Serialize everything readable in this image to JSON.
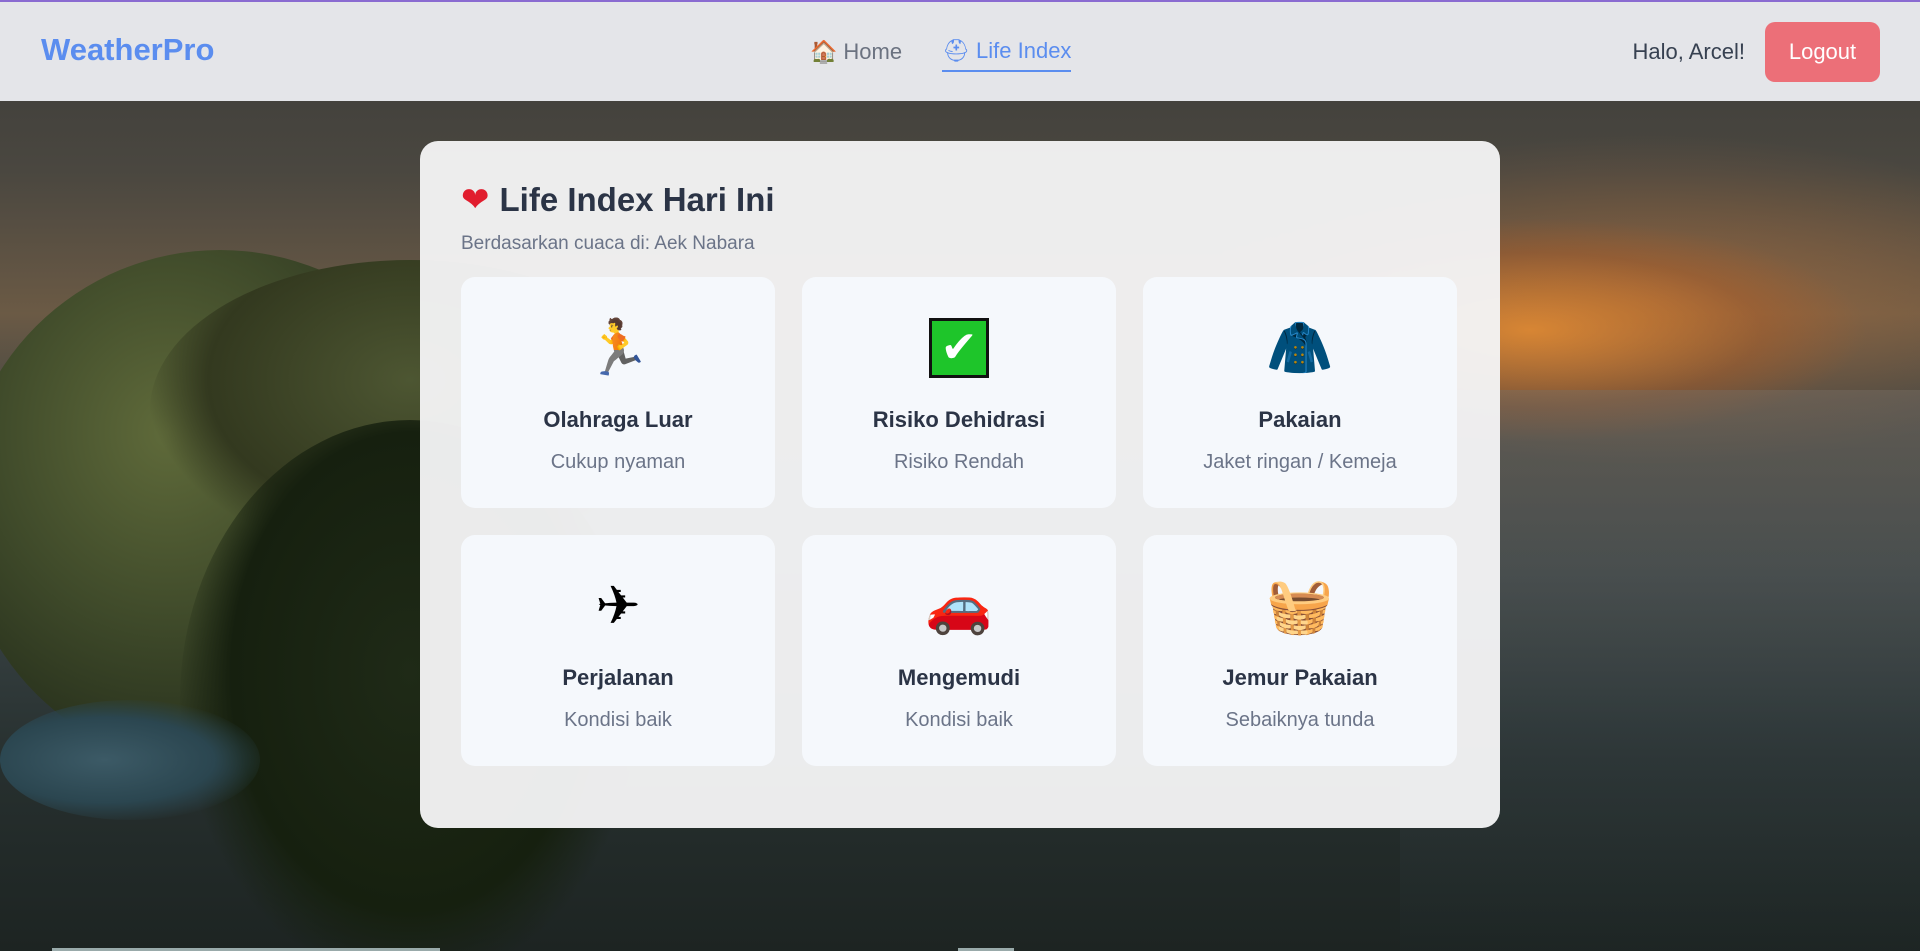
{
  "brand": {
    "name": "WeatherPro",
    "color": "#5b8def"
  },
  "nav": {
    "links": [
      {
        "label": "Home",
        "icon": "house-icon",
        "glyph": "🏠",
        "active": false
      },
      {
        "label": "Life Index",
        "icon": "life-index-icon",
        "glyph": "⛑",
        "active": true
      }
    ]
  },
  "user": {
    "greeting": "Halo, Arcel!",
    "logout_label": "Logout",
    "logout_color": "#ec6f78"
  },
  "life_index": {
    "title_icon": "heart-icon",
    "title_glyph": "❤",
    "title": "Life Index Hari Ini",
    "subtitle": "Berdasarkan cuaca di: Aek Nabara",
    "items": [
      {
        "icon": "runner-icon",
        "glyph": "🏃",
        "title": "Olahraga Luar",
        "value": "Cukup nyaman"
      },
      {
        "icon": "checkmark-icon",
        "glyph": "✔",
        "title": "Risiko Dehidrasi",
        "value": "Risiko Rendah"
      },
      {
        "icon": "jacket-icon",
        "glyph": "🧥",
        "title": "Pakaian",
        "value": "Jaket ringan / Kemeja"
      },
      {
        "icon": "airplane-icon",
        "glyph": "✈",
        "title": "Perjalanan",
        "value": "Kondisi baik"
      },
      {
        "icon": "car-icon",
        "glyph": "🚗",
        "title": "Mengemudi",
        "value": "Kondisi baik"
      },
      {
        "icon": "laundry-basket-icon",
        "glyph": "🧺",
        "title": "Jemur Pakaian",
        "value": "Sebaiknya tunda"
      }
    ]
  }
}
